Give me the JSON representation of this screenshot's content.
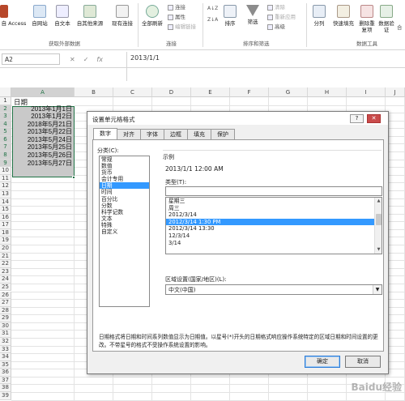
{
  "ribbon": {
    "ext_data": {
      "access": "自 Access",
      "web": "自网站",
      "text": "自文本",
      "other": "自其他来源",
      "existing": "现有连接",
      "group": "获取外部数据"
    },
    "connections": {
      "refresh_all": "全部刷新",
      "connections": "连接",
      "properties": "属性",
      "edit_links": "编辑链接",
      "group": "连接"
    },
    "sort_filter": {
      "sort": "排序",
      "filter": "筛选",
      "clear": "清除",
      "reapply": "重新应用",
      "advanced": "高级",
      "group": "排序和筛选"
    },
    "data_tools": {
      "split": "分列",
      "flash_fill": "快速填充",
      "remove_dup": "删除重复项",
      "validation": "数据验证",
      "more": "合",
      "group": "数据工具"
    }
  },
  "formula_bar": {
    "name_box": "A2",
    "cancel": "✕",
    "enter": "✓",
    "fx": "fx",
    "formula": "2013/1/1"
  },
  "sheet": {
    "columns": [
      "A",
      "B",
      "C",
      "D",
      "E",
      "F",
      "G",
      "H",
      "I",
      "J"
    ],
    "rows": [
      "1",
      "2",
      "3",
      "4",
      "5",
      "6",
      "7",
      "8",
      "9",
      "10",
      "11",
      "12",
      "13",
      "14",
      "15",
      "16",
      "17",
      "18",
      "19",
      "20",
      "21",
      "22",
      "23",
      "24",
      "25",
      "26",
      "27",
      "28",
      "29",
      "30",
      "31",
      "32",
      "33",
      "34",
      "35",
      "36",
      "37",
      "38",
      "39"
    ],
    "header_cell": "日期",
    "dates": [
      "2013年1月1日",
      "2013年1月2日",
      "2018年5月21日",
      "2013年5月22日",
      "2013年5月24日",
      "2013年5月25日",
      "2013年5月26日",
      "2013年5月27日"
    ]
  },
  "dialog": {
    "title": "设置单元格格式",
    "help": "?",
    "close": "✕",
    "tabs": [
      "数字",
      "对齐",
      "字体",
      "边框",
      "填充",
      "保护"
    ],
    "category_label": "分类(C):",
    "categories": [
      "常规",
      "数值",
      "货币",
      "会计专用",
      "日期",
      "时间",
      "百分比",
      "分数",
      "科学记数",
      "文本",
      "特殊",
      "自定义"
    ],
    "selected_category": "日期",
    "sample_label": "示例",
    "sample_value": "2013/1/1 12:00 AM",
    "type_label": "类型(T):",
    "type_input": "",
    "types": [
      "星期三",
      "周三",
      "2012/3/14",
      "2012/3/14 1:30 PM",
      "2012/3/14 13:30",
      "12/3/14",
      "3/14"
    ],
    "selected_type": "2012/3/14 1:30 PM",
    "locale_label": "区域设置(国家/地区)(L):",
    "locale_value": "中文(中国)",
    "description": "日期格式将日期和时间系列数值显示为日期值。以星号(*)开头的日期格式响应操作系统特定的区域日期和时间设置的更改。不带星号的格式不受操作系统设置的影响。",
    "ok": "确定",
    "cancel": "取消"
  },
  "watermark": "Baidu经验",
  "colors": {
    "selection_fill": "#c9c9c9",
    "selection_border": "#217346",
    "list_highlight": "#3399ff"
  }
}
